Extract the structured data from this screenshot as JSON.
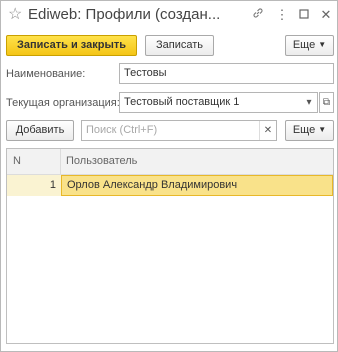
{
  "window": {
    "title": "Ediweb: Профили (создан...",
    "icons": [
      "star-icon",
      "link-icon",
      "more-vert-icon",
      "maximize-icon",
      "close-icon"
    ]
  },
  "toolbar": {
    "save_close_label": "Записать и закрыть",
    "save_label": "Записать",
    "more_label": "Еще"
  },
  "form": {
    "name_label": "Наименование:",
    "name_value": "Тестовы",
    "org_label": "Текущая организация:",
    "org_value": "Тестовый поставщик 1"
  },
  "table_toolbar": {
    "add_label": "Добавить",
    "search_placeholder": "Поиск (Ctrl+F)",
    "more_label": "Еще"
  },
  "table": {
    "columns": [
      "N",
      "Пользователь"
    ],
    "rows": [
      {
        "n": "1",
        "user": "Орлов Александр Владимирович"
      }
    ]
  },
  "colors": {
    "primary_button": "#f4c517",
    "selected_row": "#faf3d2",
    "selected_cell": "#f9e28a"
  }
}
